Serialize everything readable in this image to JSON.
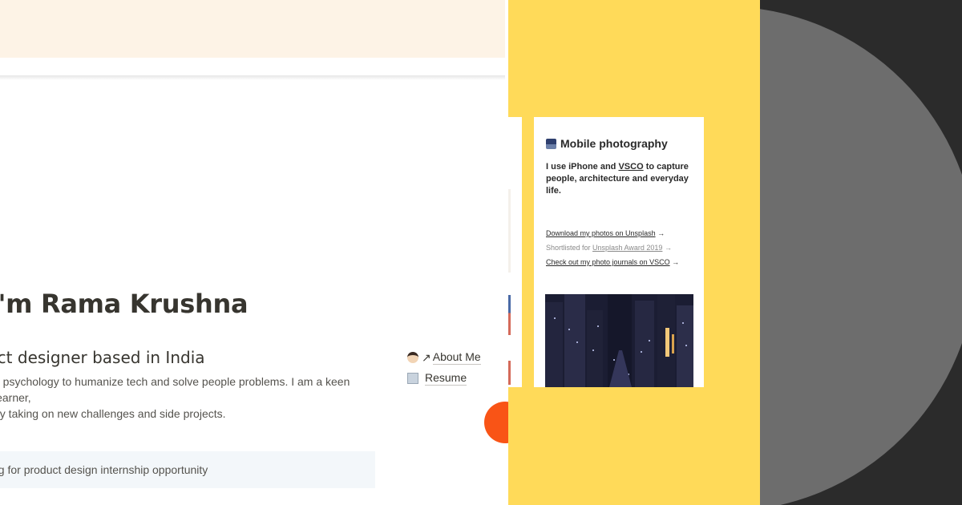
{
  "portfolio": {
    "headline": "I'm Rama Krushna",
    "subheading": "uct designer based in India",
    "bio_line_1": "e psychology to humanize tech and solve people problems. I am a keen learner,",
    "bio_line_2": "by taking on new challenges and side projects.",
    "links": [
      {
        "icon": "man-face-icon",
        "arrow": "↗",
        "label": "About Me"
      },
      {
        "icon": "document-icon",
        "label": "Resume"
      }
    ],
    "callout": "ng for product design internship opportunity"
  },
  "photography_card": {
    "icon": "city-night-icon",
    "title": "Mobile photography",
    "desc_before": "I use iPhone and ",
    "desc_link": "VSCO",
    "desc_after": " to capture people, architecture and everyday life.",
    "link_1": "Download my photos on Unsplash",
    "link_2_prefix": "Shortlisted for ",
    "link_2": "Unsplash Award 2019",
    "link_3": "Check out my photo journals on VSCO",
    "arrow": "→"
  },
  "colors": {
    "cover": "#fdf3e6",
    "yellow": "#ffda59",
    "dark": "#2b2b2b",
    "circle": "#6d6d6d",
    "orange": "#f95416",
    "callout_bg": "#f3f7fa"
  }
}
